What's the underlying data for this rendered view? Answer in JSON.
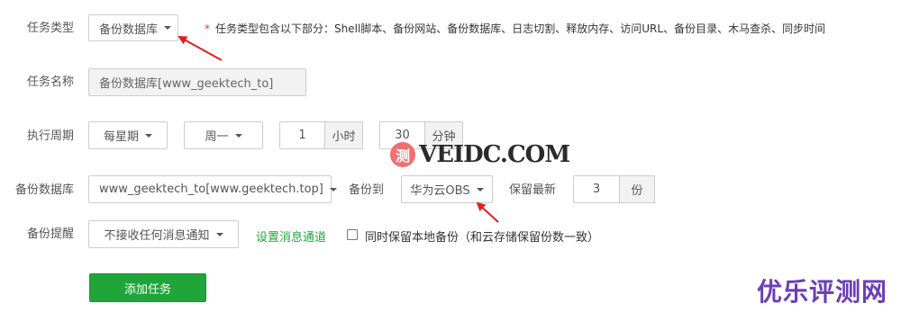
{
  "task_type": {
    "label": "任务类型",
    "value": "备份数据库",
    "hint_star": "*",
    "hint": "任务类型包含以下部分：Shell脚本、备份网站、备份数据库、日志切割、释放内存、访问URL、备份目录、木马查杀、同步时间"
  },
  "task_name": {
    "label": "任务名称",
    "value": "备份数据库[www_geektech_to]"
  },
  "period": {
    "label": "执行周期",
    "cycle": "每星期",
    "weekday": "周一",
    "hour_value": "1",
    "hour_unit": "小时",
    "minute_value": "30",
    "minute_unit": "分钟"
  },
  "backup": {
    "db_label": "备份数据库",
    "db_value": "www_geektech_to[www.geektech.top]",
    "to_label": "备份到",
    "to_value": "华为云OBS",
    "keep_label": "保留最新",
    "keep_value": "3",
    "keep_unit": "份"
  },
  "notify": {
    "label": "备份提醒",
    "value": "不接收任何消息通知",
    "link": "设置消息通道",
    "checkbox_label": "同时保留本地备份（和云存储保留份数一致）",
    "checked": false
  },
  "submit_label": "添加任务",
  "watermark": {
    "glyph": "测",
    "text": "VEIDC.COM"
  },
  "brand": "优乐评测网",
  "colors": {
    "accent": "#20a53a",
    "required": "#ee3333",
    "annotation_arrow": "#e02020",
    "brand": "#6a3fb5"
  }
}
